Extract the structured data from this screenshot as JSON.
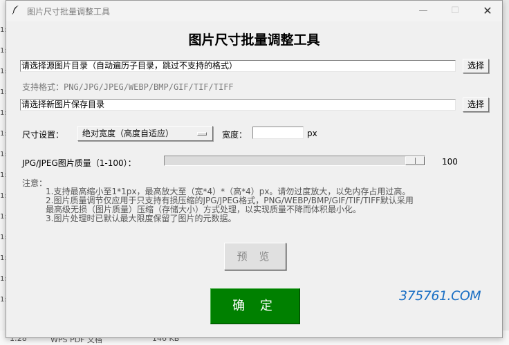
{
  "background": {
    "left_fragments": [
      "1:",
      "1:",
      "1:",
      "1:",
      "1:",
      "1:",
      "1:",
      "1:",
      "1:",
      "1:",
      "1:",
      "1:",
      "1:",
      "1:"
    ],
    "bottom": {
      "time": "1:28",
      "file_type": "WPS PDF 文档",
      "size": "146 KB"
    }
  },
  "window": {
    "title": "图片尺寸批量调整工具",
    "icon": "feather-icon",
    "controls": {
      "minimize": "—",
      "maximize": "☐",
      "close": "✕"
    }
  },
  "main": {
    "title": "图片尺寸批量调整工具",
    "source": {
      "value": "请选择源图片目录（自动遍历子目录，跳过不支持的格式）",
      "button": "选择"
    },
    "formats_hint": "支持格式：PNG/JPG/JPEG/WEBP/BMP/GIF/TIF/TIFF",
    "dest": {
      "value": "请选择新图片保存目录",
      "button": "选择"
    },
    "size": {
      "label": "尺寸设置：",
      "mode": "绝对宽度（高度自适应）",
      "width_label": "宽度：",
      "width_value": "",
      "unit": "px"
    },
    "quality": {
      "label": "JPG/JPEG图片质量（1-100）：",
      "value": "100",
      "level": 100,
      "min": 1,
      "max": 100
    },
    "notes": {
      "heading": "注意：",
      "lines": [
        "1.支持最高缩小至1*1px，最高放大至（宽*4）*（高*4）px。请勿过度放大，以免内存占用过高。",
        "2.图片质量调节仅应用于只支持有损压缩的JPG/JPEG格式，PNG/WEBP/BMP/GIF/TIF/TIFF默认采用",
        "  最高级无损（图片质量）压缩（存储大小）方式处理，以实现质量不降而体积最小化。",
        "3.图片处理时已默认最大限度保留了图片的元数据。"
      ]
    },
    "preview_button": "预 览",
    "ok_button": "确 定"
  },
  "watermark": "375761.COM",
  "colors": {
    "ok_button": "#008000",
    "watermark": "#1a6fc4",
    "window_bg": "#f0f0f0"
  }
}
